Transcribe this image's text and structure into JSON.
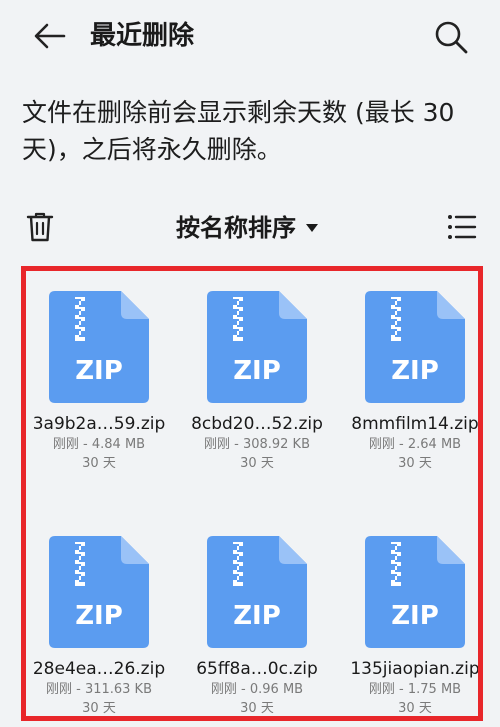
{
  "header": {
    "title": "最近删除",
    "back_icon": "back-arrow-icon",
    "search_icon": "search-icon"
  },
  "info": {
    "text": "文件在删除前会显示剩余天数 (最长 30 天)，之后将永久删除。"
  },
  "toolbar": {
    "delete_icon": "trash-icon",
    "sort_label": "按名称排序",
    "list_icon": "list-view-icon"
  },
  "colors": {
    "background": "#f1f3f5",
    "zip_icon": "#5b9cf0",
    "zip_fold": "#9ac2f7",
    "highlight_border": "#e8262a"
  },
  "files": [
    {
      "name": "3a9b2a…59.zip",
      "meta": "刚刚 - 4.84 MB",
      "days": "30 天",
      "badge": "ZIP"
    },
    {
      "name": "8cbd20…52.zip",
      "meta": "刚刚 - 308.92 KB",
      "days": "30 天",
      "badge": "ZIP"
    },
    {
      "name": "8mmfilm14.zip",
      "meta": "刚刚 - 2.64 MB",
      "days": "30 天",
      "badge": "ZIP"
    },
    {
      "name": "28e4ea…26.zip",
      "meta": "刚刚 - 311.63 KB",
      "days": "30 天",
      "badge": "ZIP"
    },
    {
      "name": "65ff8a…0c.zip",
      "meta": "刚刚 - 0.96 MB",
      "days": "30 天",
      "badge": "ZIP"
    },
    {
      "name": "135jiaopian.zip",
      "meta": "刚刚 - 1.75 MB",
      "days": "30 天",
      "badge": "ZIP"
    }
  ]
}
